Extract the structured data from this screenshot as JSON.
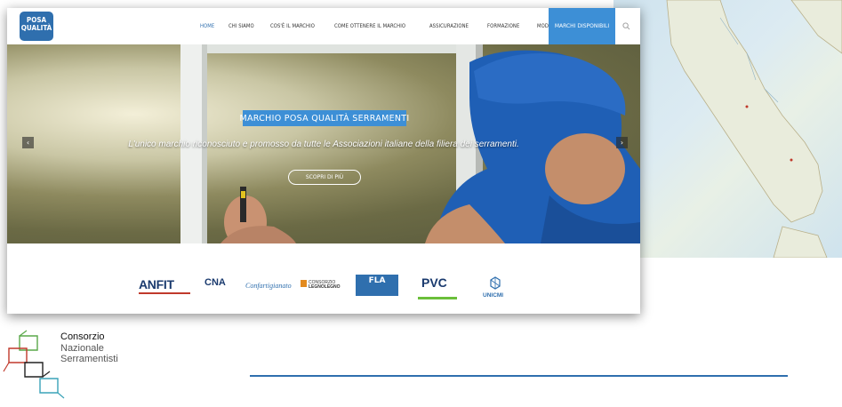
{
  "navbar": {
    "logo_line1": "POSA",
    "logo_line2": "QUALITÀ",
    "items": [
      {
        "label": "HOME"
      },
      {
        "label": "CHI SIAMO"
      },
      {
        "label": "COS'È IL MARCHIO"
      },
      {
        "label": "COME OTTENERE IL MARCHIO"
      },
      {
        "label": "ASSICURAZIONE"
      },
      {
        "label": "FORMAZIONE"
      },
      {
        "label": "MODULISTICA"
      }
    ],
    "cta_label": "MARCHI DISPONIBILI",
    "search_icon": "search-icon"
  },
  "hero": {
    "title": "MARCHIO POSA QUALITÀ SERRAMENTI",
    "subtitle": "L'unico marchio riconosciuto e promosso da tutte le Associazioni italiane della filiera dei serramenti.",
    "button_label": "SCOPRI DI PIÙ",
    "prev_icon": "chevron-left-icon",
    "next_icon": "chevron-right-icon"
  },
  "partners": {
    "anfit": "ANFIT",
    "cna": "CNA",
    "confartigianato": "Confartigianato",
    "legno_line1": "CONSORZIO",
    "legno_line2": "LEGNOLEGNO",
    "fla": "FLA",
    "pvc": "PVC",
    "unicmi": "UNICMI"
  },
  "footer_logo": {
    "line1": "Consorzio",
    "line2": "Nazionale",
    "line3": "Serramentisti"
  },
  "colors": {
    "accent": "#3d8fd6",
    "brand_dark": "#2f6fae",
    "navy": "#1a3a6e"
  }
}
